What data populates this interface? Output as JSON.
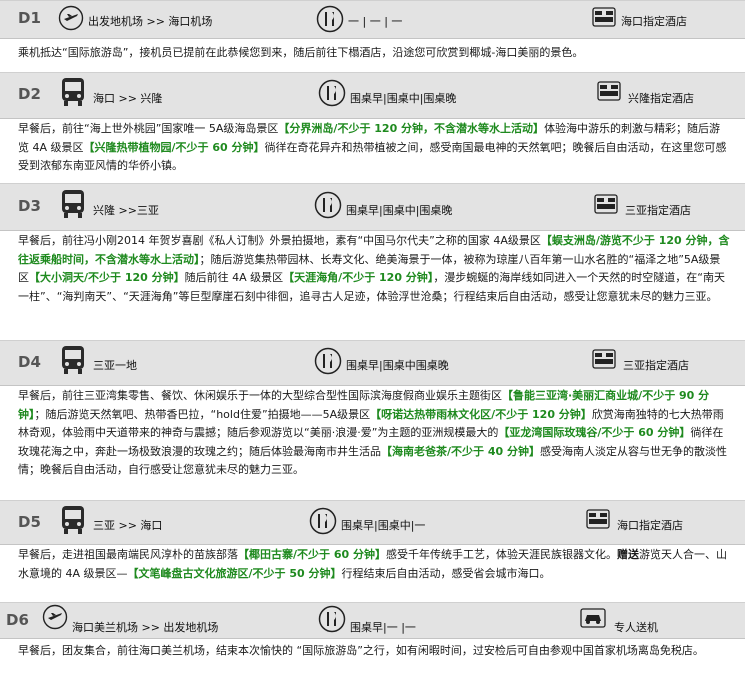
{
  "days": [
    {
      "day": "D1",
      "route": "出发地机场 >> 海口机场",
      "meals": "一 | 一 | 一",
      "hotel": "海口指定酒店",
      "desc": [
        {
          "t": "乘机抵达“国际旅游岛”，接机员已提前在此恭候您到来，随后前往下榻酒店，沿途您可欣赏到椰城-海口美丽的景色。"
        }
      ]
    },
    {
      "day": "D2",
      "route": "海口 >> 兴隆",
      "meals": "围桌早|围桌中|围桌晚",
      "hotel": "兴隆指定酒店",
      "desc": [
        {
          "t": "早餐后，前往“海上世外桃园”国家唯一 5A级海岛景区"
        },
        {
          "t": "【分界洲岛/不少于 120 分钟，不含潜水等水上活动】",
          "h": true
        },
        {
          "t": "体验海中游乐的刺激与精彩；随后游览 4A 级景区"
        },
        {
          "t": "【兴隆热带植物园/不少于 60 分钟】",
          "h": true
        },
        {
          "t": "徜徉在奇花异卉和热带植被之间，感受南国最电神的天然氧吧；晚餐后自由活动，在这里您可感受到浓郁东南亚风情的华侨小镇。"
        }
      ]
    },
    {
      "day": "D3",
      "route": "兴隆 >>三亚",
      "meals": "围桌早|围桌中|围桌晚",
      "hotel": "三亚指定酒店",
      "desc": [
        {
          "t": "早餐后，前往冯小刚2014 年贺岁喜剧《私人订制》外景拍摄地，素有“中国马尔代夫”之称的国家 4A级景区"
        },
        {
          "t": "【蜈支洲岛/游览不少于 120 分钟，含往返乘船时间，不含潜水等水上活动】",
          "h": true
        },
        {
          "t": "；随后游览集热带园林、长寿文化、绝美海景于一体，被称为琼崖八百年第一山水名胜的“福泽之地”5A级景区"
        },
        {
          "t": "【大小洞天/不少于 120 分钟】",
          "h": true
        },
        {
          "t": "随后前往 4A 级景区"
        },
        {
          "t": "【天涯海角/不少于 120 分钟】",
          "h": true
        },
        {
          "t": "，漫步蜿蜒的海岸线如同进入一个天然的时空隧道，在“南天一柱”、“海判南天”、“天涯海角”等巨型摩崖石刻中徘徊，追寻古人足迹，体验浮世沧桑；行程结束后自由活动，感受让您意犹未尽的魅力三亚。"
        }
      ]
    },
    {
      "day": "D4",
      "route": "三亚一地",
      "meals": "围桌早|围桌中围桌晚",
      "hotel": "三亚指定酒店",
      "desc": [
        {
          "t": "早餐后，前往三亚湾集零售、餐饮、休闲娱乐于一体的大型综合型性国际滨海度假商业娱乐主题街区"
        },
        {
          "t": "【鲁能三亚湾·美丽汇商业城/不少于 90 分钟】",
          "h": true
        },
        {
          "t": "；随后游览天然氧吧、热带香巴拉，“hold住爱”拍摄地——5A级景区"
        },
        {
          "t": "【呀诺达热带雨林文化区/不少于 120 分钟】",
          "h": true
        },
        {
          "t": "欣赏海南独特的七大热带雨林奇观，体验雨中天道带来的神奇与震撼；随后参观游览以“美丽·浪漫·爱”为主题的亚洲规模最大的"
        },
        {
          "t": "【亚龙湾国际玫瑰谷/不少于 60 分钟】",
          "h": true
        },
        {
          "t": "徜徉在玫瑰花海之中，奔赴一场极致浪漫的玫瑰之约；随后体验最海南市井生活品"
        },
        {
          "t": "【海南老爸茶/不少于 40 分钟】",
          "h": true
        },
        {
          "t": "感受海南人淡定从容与世无争的散淡性情；晚餐后自由活动，自行感受让您意犹未尽的魅力三亚。"
        }
      ]
    },
    {
      "day": "D5",
      "route": "三亚 >> 海口",
      "meals": "围桌早|围桌中|一",
      "hotel": "海口指定酒店",
      "desc": [
        {
          "t": "早餐后，走进祖国最南端民风淳朴的苗族部落"
        },
        {
          "t": "【椰田古寨/不少于 60 分钟】",
          "h": true
        },
        {
          "t": "感受千年传统手工艺，体验天涯民族银器文化。"
        },
        {
          "t": "赠送",
          "h": true,
          "b": true
        },
        {
          "t": "游览天人合一、山水意境的 4A 级景区—"
        },
        {
          "t": "【文笔峰盘古文化旅游区/不少于 50 分钟】",
          "h": true
        },
        {
          "t": "行程结束后自由活动，感受省会城市海口。"
        }
      ]
    },
    {
      "day": "D6",
      "route": "海口美兰机场 >> 出发地机场",
      "meals": "围桌早|一 |一",
      "hotel": "专人送机",
      "desc": [
        {
          "t": "早餐后，团友集合，前往海口美兰机场，结束本次愉快的 “国际旅游岛”之行，如有闲暇时间，过安检后可自由参观中国首家机场离岛免税店。"
        }
      ]
    }
  ]
}
